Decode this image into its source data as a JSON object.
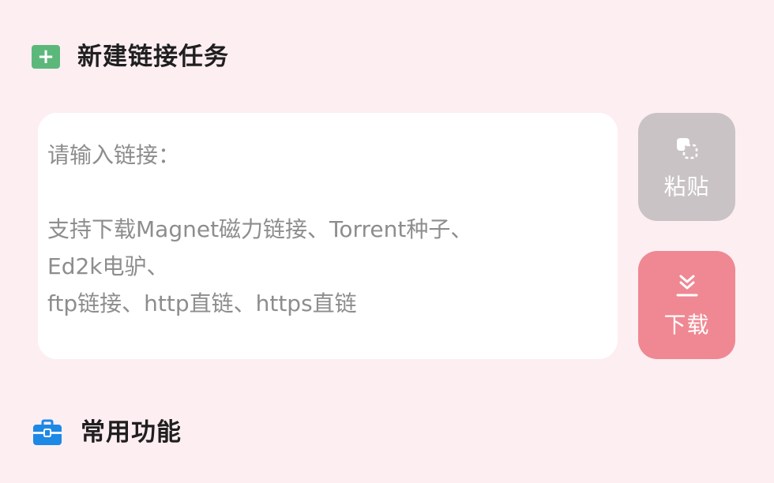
{
  "new_task": {
    "title": "新建链接任务",
    "icon": "plus-square-icon",
    "icon_color": "#5cb87a"
  },
  "link_input": {
    "value": "",
    "placeholder": "请输入链接：\n\n支持下载Magnet磁力链接、Torrent种子、\nEd2k电驴、\nftp链接、http直链、https直链"
  },
  "paste_button": {
    "label": "粘贴",
    "icon": "paste-icon",
    "color": "#c9c3c6"
  },
  "download_button": {
    "label": "下载",
    "icon": "download-icon",
    "color": "#ef8893"
  },
  "common_features": {
    "title": "常用功能",
    "icon": "toolbox-icon",
    "icon_color": "#1e88e5"
  },
  "colors": {
    "background": "#fdeef2",
    "card": "#ffffff",
    "placeholder_text": "#8d8d8d"
  }
}
